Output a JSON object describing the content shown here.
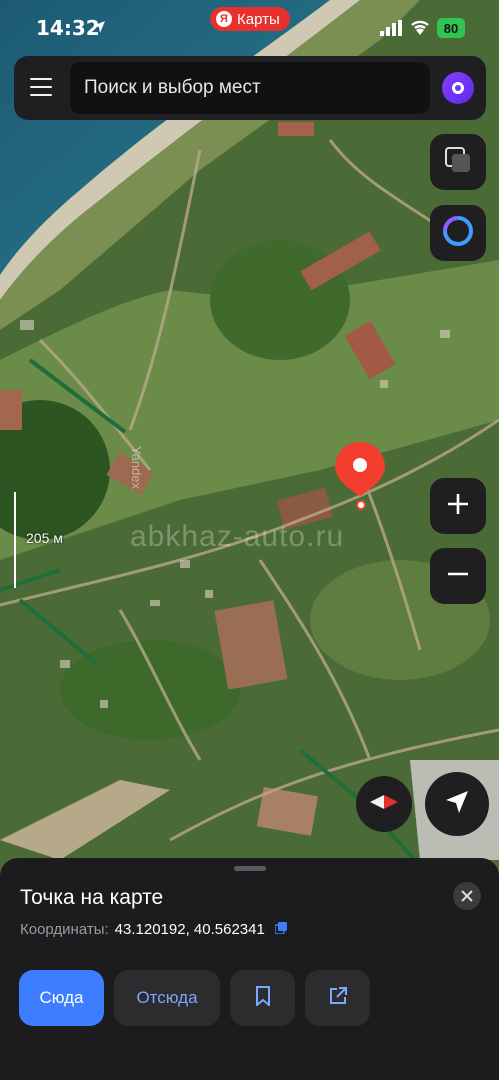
{
  "status": {
    "time": "14:32",
    "app_pill": "Карты",
    "app_pill_logo": "Я",
    "battery": "80"
  },
  "search": {
    "placeholder": "Поиск и выбор мест"
  },
  "map": {
    "watermark": "abkhaz-auto.ru",
    "provider_mark": "Yandex",
    "scale_label": "205 м"
  },
  "card": {
    "title": "Точка на карте",
    "coords_label": "Координаты:",
    "coords_value": "43.120192, 40.562341",
    "actions": {
      "to_here": "Сюда",
      "from_here": "Отсюда"
    }
  },
  "icons": [
    "location-arrow-icon",
    "signal-icon",
    "wifi-icon",
    "menu-icon",
    "alice-icon",
    "layers-icon",
    "alice-bubble-icon",
    "zoom-in-icon",
    "zoom-out-icon",
    "compass-icon",
    "my-location-icon",
    "close-icon",
    "copy-icon",
    "bookmark-icon",
    "share-icon"
  ],
  "colors": {
    "accent": "#3d7dff",
    "pin": "#f33d2e",
    "sheet": "#1c1c1e"
  }
}
